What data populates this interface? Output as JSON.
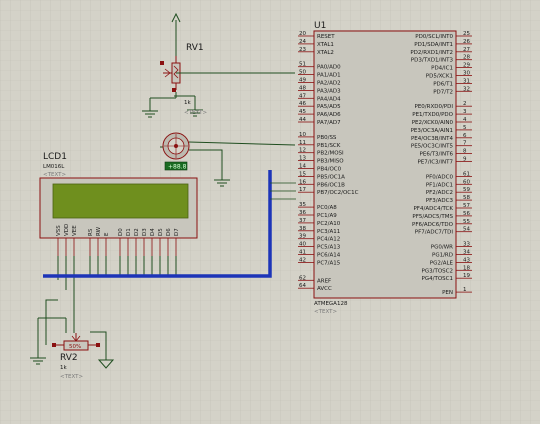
{
  "components": {
    "u1": {
      "ref": "U1",
      "part": "ATMEGA128",
      "text_placeholder": "<TEXT>",
      "left_pins": [
        {
          "num": "20",
          "name": "RESET"
        },
        {
          "num": "24",
          "name": "XTAL1"
        },
        {
          "num": "23",
          "name": "XTAL2"
        },
        {
          "num": "51",
          "name": "PA0/AD0"
        },
        {
          "num": "50",
          "name": "PA1/AD1"
        },
        {
          "num": "49",
          "name": "PA2/AD2"
        },
        {
          "num": "48",
          "name": "PA3/AD3"
        },
        {
          "num": "47",
          "name": "PA4/AD4"
        },
        {
          "num": "46",
          "name": "PA5/AD5"
        },
        {
          "num": "45",
          "name": "PA6/AD6"
        },
        {
          "num": "44",
          "name": "PA7/AD7"
        },
        {
          "num": "10",
          "name": "PB0/SS"
        },
        {
          "num": "11",
          "name": "PB1/SCK"
        },
        {
          "num": "12",
          "name": "PB2/MOSI"
        },
        {
          "num": "13",
          "name": "PB3/MISO"
        },
        {
          "num": "14",
          "name": "PB4/OC0"
        },
        {
          "num": "15",
          "name": "PB5/OC1A"
        },
        {
          "num": "16",
          "name": "PB6/OC1B"
        },
        {
          "num": "17",
          "name": "PB7/OC2/OC1C"
        },
        {
          "num": "35",
          "name": "PC0/A8"
        },
        {
          "num": "36",
          "name": "PC1/A9"
        },
        {
          "num": "37",
          "name": "PC2/A10"
        },
        {
          "num": "38",
          "name": "PC3/A11"
        },
        {
          "num": "39",
          "name": "PC4/A12"
        },
        {
          "num": "40",
          "name": "PC5/A13"
        },
        {
          "num": "41",
          "name": "PC6/A14"
        },
        {
          "num": "42",
          "name": "PC7/A15"
        },
        {
          "num": "62",
          "name": "AREF"
        },
        {
          "num": "64",
          "name": "AVCC"
        }
      ],
      "right_pins": [
        {
          "num": "25",
          "name": "PD0/SCL/INT0"
        },
        {
          "num": "26",
          "name": "PD1/SDA/INT1"
        },
        {
          "num": "27",
          "name": "PD2/RXD1/INT2"
        },
        {
          "num": "28",
          "name": "PD3/TXD1/INT3"
        },
        {
          "num": "29",
          "name": "PD4/IC1"
        },
        {
          "num": "30",
          "name": "PD5/XCK1"
        },
        {
          "num": "31",
          "name": "PD6/T1"
        },
        {
          "num": "32",
          "name": "PD7/T2"
        },
        {
          "num": "2",
          "name": "PE0/RXD0/PDI"
        },
        {
          "num": "3",
          "name": "PE1/TXD0/PDO"
        },
        {
          "num": "4",
          "name": "PE2/XCK0/AIN0"
        },
        {
          "num": "5",
          "name": "PE3/OC3A/AIN1"
        },
        {
          "num": "6",
          "name": "PE4/OC3B/INT4"
        },
        {
          "num": "7",
          "name": "PE5/OC3C/INT5"
        },
        {
          "num": "8",
          "name": "PE6/T3/INT6"
        },
        {
          "num": "9",
          "name": "PE7/IC3/INT7"
        },
        {
          "num": "61",
          "name": "PF0/ADC0"
        },
        {
          "num": "60",
          "name": "PF1/ADC1"
        },
        {
          "num": "59",
          "name": "PF2/ADC2"
        },
        {
          "num": "58",
          "name": "PF3/ADC3"
        },
        {
          "num": "57",
          "name": "PF4/ADC4/TCK"
        },
        {
          "num": "56",
          "name": "PF5/ADC5/TMS"
        },
        {
          "num": "55",
          "name": "PF6/ADC6/TDO"
        },
        {
          "num": "54",
          "name": "PF7/ADC7/TDI"
        },
        {
          "num": "33",
          "name": "PG0/WR"
        },
        {
          "num": "34",
          "name": "PG1/RD"
        },
        {
          "num": "43",
          "name": "PG2/ALE"
        },
        {
          "num": "18",
          "name": "PG3/TOSC2"
        },
        {
          "num": "19",
          "name": "PG4/TOSC1"
        },
        {
          "num": "1",
          "name": "PEN"
        }
      ]
    },
    "lcd1": {
      "ref": "LCD1",
      "part": "LM016L",
      "text_placeholder": "<TEXT>",
      "pins": [
        "VSS",
        "VDD",
        "VEE",
        "RS",
        "RW",
        "E",
        "D0",
        "D1",
        "D2",
        "D3",
        "D4",
        "D5",
        "D6",
        "D7"
      ]
    },
    "rv1": {
      "ref": "RV1",
      "value": "1k",
      "text_placeholder": "<TEXT>"
    },
    "rv2": {
      "ref": "RV2",
      "value": "1k",
      "text_placeholder": "<TEXT>",
      "body_label": "50%"
    },
    "motor": {
      "indicator_label": "+88.8"
    }
  },
  "colors": {
    "background": "#d4d2c8",
    "grid": "#c2c0b5",
    "wire": "#1f4d1f",
    "bus": "#1d34b8",
    "pin": "#8a1010",
    "chip_fill": "#c8c6bd",
    "lcd_screen": "#6f8f1e",
    "indicator": "#1a6b22"
  }
}
